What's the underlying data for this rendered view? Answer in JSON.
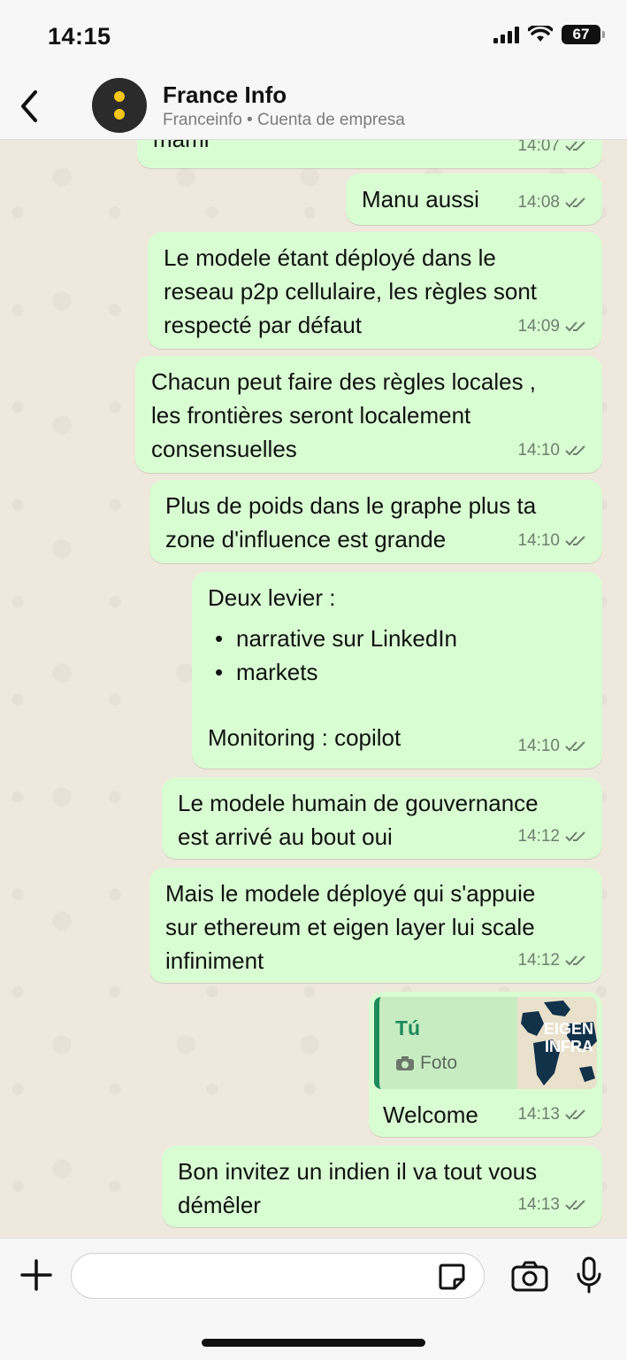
{
  "status_bar": {
    "time": "14:15",
    "battery": "67"
  },
  "header": {
    "contact_name": "France Info",
    "contact_subtitle": "Franceinfo  • Cuenta de empresa"
  },
  "messages": [
    {
      "text": "mami",
      "time": "14:07"
    },
    {
      "text": "Manu aussi",
      "time": "14:08"
    },
    {
      "text": "Le modele étant déployé dans le\nreseau p2p cellulaire, les règles sont\nrespecté par défaut",
      "time": "14:09"
    },
    {
      "text": "Chacun peut faire des règles locales ,\nles frontières seront localement\nconsensuelles",
      "time": "14:10"
    },
    {
      "text": "Plus de poids dans le graphe plus ta\nzone d'influence est grande",
      "time": "14:10"
    },
    {
      "intro": "Deux levier :",
      "bullets": [
        "narrative sur LinkedIn",
        "markets"
      ],
      "outro": "Monitoring : copilot",
      "time": "14:10"
    },
    {
      "text": "Le modele humain de gouvernance\nest arrivé au bout oui",
      "time": "14:12"
    },
    {
      "text": "Mais le modele déployé qui s'appuie\nsur ethereum et eigen layer lui scale\ninfiniment",
      "time": "14:12"
    },
    {
      "quote_author": "Tú",
      "quote_type": "Foto",
      "quote_thumb_text": "EIGEN\nINFRA",
      "text": "Welcome",
      "time": "14:13"
    },
    {
      "text": "Bon invitez un indien il va tout vous\ndémêler",
      "time": "14:13"
    }
  ],
  "input": {
    "placeholder": ""
  },
  "colors": {
    "bubble_out": "#d9fdd3",
    "accent": "#1f8a5c",
    "background": "#efeae2"
  },
  "icons": [
    "back-arrow",
    "plus",
    "sticker",
    "camera",
    "microphone",
    "double-check"
  ]
}
